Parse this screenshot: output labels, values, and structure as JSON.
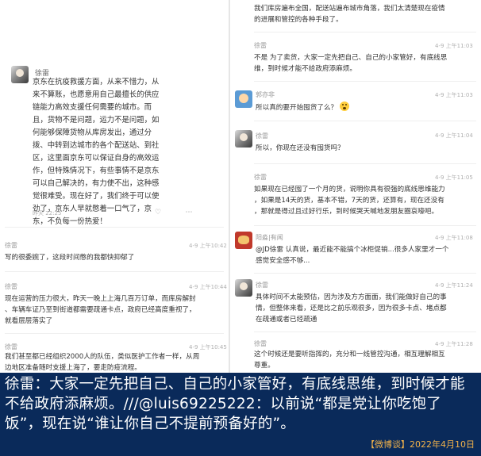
{
  "left": {
    "top_post": {
      "author": "徐雷",
      "lines": [
        "京东在抗疫救援方面，从来不惜力，从",
        "来不算账，也愿意用自己最擅长的供应",
        "链能力高效支援任何需要的城市。而",
        "且，货物不是问题，运力不是问题，如",
        "何能够保障货物从库房发出，通过分",
        "拨、中转到达城市的各个配送站、到社",
        "区，这里面京东可以保证自身的高效运",
        "作，但特殊情况下，有些事情不是京东",
        "可以自己解决的，有力使不出，这种感",
        "觉很难受。现在好了，我们终于可以使",
        "劲了，京东人早就憋着一口气了，京",
        "东，不负每一份热爱！"
      ],
      "time": "昨天 22:25"
    },
    "comments": [
      {
        "author": "徐雷",
        "time": "4-9 上午10:42",
        "lines": [
          "写的很委婉了，这段时间憋的我都快抑郁了"
        ]
      },
      {
        "author": "徐雷",
        "time": "4-9 上午10:44",
        "lines": [
          "现在运营的压力很大，昨天一晚上上海几百万订单，而库房解封",
          "、车辆车证乃至到街道都需要疏通卡点，政府已经高度重视了，",
          "就看层层落实了"
        ]
      },
      {
        "author": "徐雷",
        "time": "4-9 上午10:45",
        "lines": [
          "我们甚至都已经组织2000人的队伍，类似医护工作者一样，从周",
          "边地区准备随时支援上海了，要走防疫流程。"
        ]
      }
    ]
  },
  "right": {
    "top_lines": [
      "我们库房遍布全国，配送站遍布城市角落，我们太清楚现在疫情",
      "的进展和管控的各种手段了。"
    ],
    "comments": [
      {
        "author": "徐雷",
        "time": "4-9 上午11:03",
        "lines": [
          "不是 为了卖货，大家一定先把自己、自己的小家管好，有底线思",
          "维，到时候才能不给政府添麻烦。"
        ]
      },
      {
        "author": "郭亦非",
        "time": "4-9 上午11:03",
        "lines": [
          "所以真的要开始囤货了么？"
        ]
      },
      {
        "author": "徐雷",
        "time": "4-9 上午11:04",
        "lines": [
          "所以，你现在还没有囤货吗？"
        ]
      },
      {
        "author": "徐雷",
        "time": "4-9 上午11:05",
        "lines": [
          "如果现在已经囤了一个月的货，说明你具有很强的底线思维能力",
          "，如果是14天的货，基本不错，7天的货，还算有，现在还没有",
          "，那就是得过且过好行乐，到时候哭天喊地发朋友圈哀嚎吧。"
        ]
      },
      {
        "author": "阳淼|有闻",
        "time": "4-9 上午11:08",
        "lines": [
          "@JD徐雷 认真说，最近能不能搞个冰柜促销...很多人家里才一个",
          "感觉安全感不够..."
        ]
      },
      {
        "author": "徐雷",
        "time": "4-9 上午11:24",
        "lines": [
          "具体时间不太能预估，因为涉及方方面面，我们能做好自己的事",
          "情，但整体来看，还是比之前乐观很多，因为很多卡点、堵点都",
          "在疏通或者已经疏通"
        ]
      },
      {
        "author": "徐雷",
        "time": "4-9 上午11:28",
        "lines": [
          "这个时候还是要听指挥的，充分和一线管控沟通，相互理解相互",
          "尊重。"
        ]
      }
    ]
  },
  "caption": {
    "text": "徐雷：大家一定先把自己、自己的小家管好，有底线思维，到时候才能不给政府添麻烦。///@luis69225222：以前说“都是党让你吃饱了饭”，现在说“谁让你自己不提前预备好的”。",
    "source": "【微博谈】2022年4月10日"
  }
}
